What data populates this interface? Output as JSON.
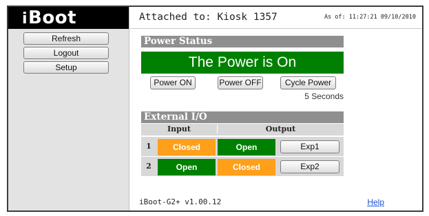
{
  "logo": {
    "prefix": "i",
    "name": "Boot"
  },
  "nav": {
    "refresh": "Refresh",
    "logout": "Logout",
    "setup": "Setup"
  },
  "header": {
    "attached": "Attached to: Kiosk 1357",
    "as_of": "As of: 11:27:21 09/10/2010"
  },
  "power": {
    "section_title": "Power Status",
    "status": "The Power is On",
    "status_color": "#008000",
    "btn_on": "Power ON",
    "btn_off": "Power OFF",
    "btn_cycle": "Cycle Power",
    "cycle_note": "5 Seconds"
  },
  "io": {
    "section_title": "External I/O",
    "header_input": "Input",
    "header_output": "Output",
    "rows": [
      {
        "num": "1",
        "input": "Closed",
        "input_color": "#ff9f1a",
        "output": "Open",
        "output_color": "#008000",
        "button": "Exp1"
      },
      {
        "num": "2",
        "input": "Open",
        "input_color": "#008000",
        "output": "Closed",
        "output_color": "#ff9f1a",
        "button": "Exp2"
      }
    ]
  },
  "footer": {
    "version": "iBoot-G2+ v1.00.12",
    "help": "Help"
  }
}
